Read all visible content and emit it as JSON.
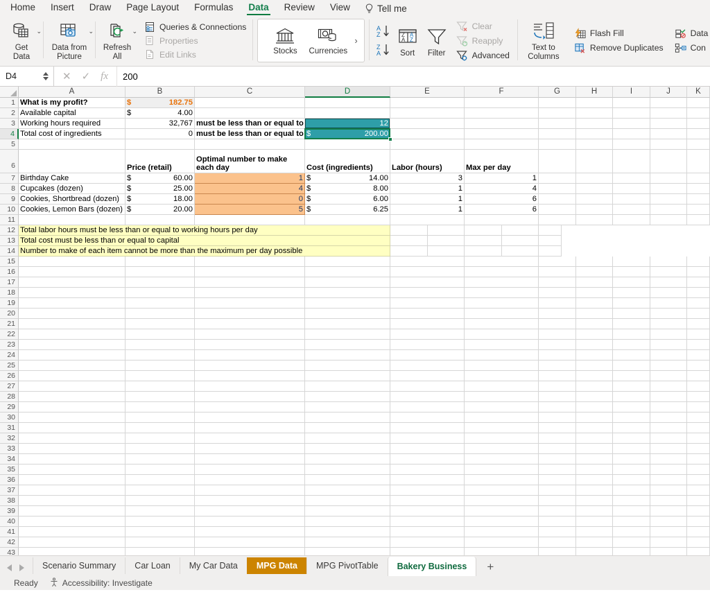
{
  "ribbon": {
    "tabs": [
      {
        "label": "Home",
        "active": false
      },
      {
        "label": "Insert",
        "active": false
      },
      {
        "label": "Draw",
        "active": false
      },
      {
        "label": "Page Layout",
        "active": false
      },
      {
        "label": "Formulas",
        "active": false
      },
      {
        "label": "Data",
        "active": true
      },
      {
        "label": "Review",
        "active": false
      },
      {
        "label": "View",
        "active": false
      }
    ],
    "tell_me": "Tell me",
    "get_data": "Get\nData",
    "get_data_line1": "Get",
    "get_data_line2": "Data",
    "data_from_picture_line1": "Data from",
    "data_from_picture_line2": "Picture",
    "refresh_all_line1": "Refresh",
    "refresh_all_line2": "All",
    "queries_connections": "Queries & Connections",
    "properties": "Properties",
    "edit_links": "Edit Links",
    "stocks": "Stocks",
    "currencies": "Currencies",
    "gallery_more": "›",
    "sort": "Sort",
    "filter": "Filter",
    "clear": "Clear",
    "reapply": "Reapply",
    "advanced": "Advanced",
    "text_to_columns_line1": "Text to",
    "text_to_columns_line2": "Columns",
    "flash_fill": "Flash Fill",
    "remove_duplicates": "Remove Duplicates",
    "data_validation": "Data",
    "consolidate": "Con"
  },
  "formula_bar": {
    "name_box": "D4",
    "cancel": "✕",
    "enter": "✓",
    "fx": "fx",
    "value": "200"
  },
  "grid": {
    "columns": [
      "A",
      "B",
      "C",
      "D",
      "E",
      "F",
      "G",
      "H",
      "I",
      "J",
      "K"
    ],
    "selected_column": "D",
    "selected_row": 4,
    "row_count": 43
  },
  "cells": {
    "a1": "What is my profit?",
    "b1_symbol": "$",
    "b1_value": "182.75",
    "a2": "Available capital",
    "b2_symbol": "$",
    "b2_value": "4.00",
    "a3": "Working hours required",
    "b3_value": "32,767",
    "c3": "must be less than or equal to",
    "d3_value": "12",
    "a4": "Total cost of ingredients",
    "b4_value": "0",
    "c4": "must be less than or equal to",
    "d4_symbol": "$",
    "d4_value": "200.00",
    "header_price": "Price (retail)",
    "header_optimal": "Optimal number to make each day",
    "header_cost": "Cost (ingredients)",
    "header_labor": "Labor (hours)",
    "header_max": "Max per day",
    "note12": "Total labor hours must be less than or equal to working hours per day",
    "note13": "Total cost must be less than or equal to capital",
    "note14": "Number to make of each item cannot be more than the maximum per day possible"
  },
  "table_data": {
    "headers": [
      "",
      "Price (retail)",
      "Optimal number to make each day",
      "Cost (ingredients)",
      "Labor (hours)",
      "Max per day"
    ],
    "rows": [
      {
        "name": "Birthday Cake",
        "price_symbol": "$",
        "price": "60.00",
        "optimal": "1",
        "cost_symbol": "$",
        "cost": "14.00",
        "labor": "3",
        "max": "1"
      },
      {
        "name": "Cupcakes (dozen)",
        "price_symbol": "$",
        "price": "25.00",
        "optimal": "4",
        "cost_symbol": "$",
        "cost": "8.00",
        "labor": "1",
        "max": "4"
      },
      {
        "name": "Cookies, Shortbread (dozen)",
        "price_symbol": "$",
        "price": "18.00",
        "optimal": "0",
        "cost_symbol": "$",
        "cost": "6.00",
        "labor": "1",
        "max": "6"
      },
      {
        "name": "Cookies, Lemon Bars (dozen)",
        "price_symbol": "$",
        "price": "20.00",
        "optimal": "5",
        "cost_symbol": "$",
        "cost": "6.25",
        "labor": "1",
        "max": "6"
      }
    ]
  },
  "sheet_tabs": {
    "items": [
      {
        "label": "Scenario Summary",
        "state": "normal"
      },
      {
        "label": "Car Loan",
        "state": "normal"
      },
      {
        "label": "My Car Data",
        "state": "normal"
      },
      {
        "label": "MPG Data",
        "state": "highlight"
      },
      {
        "label": "MPG PivotTable",
        "state": "normal"
      },
      {
        "label": "Bakery Business",
        "state": "active"
      }
    ],
    "add_label": "+"
  },
  "status_bar": {
    "ready": "Ready",
    "accessibility": "Accessibility: Investigate"
  },
  "colors": {
    "excel_green": "#107c41",
    "teal_fill": "#2E9EA8",
    "orange_fill": "#FBC28C",
    "yellow_fill": "#FFFFC2",
    "orange_text": "#E8730C",
    "tab_highlight": "#CC8400"
  }
}
